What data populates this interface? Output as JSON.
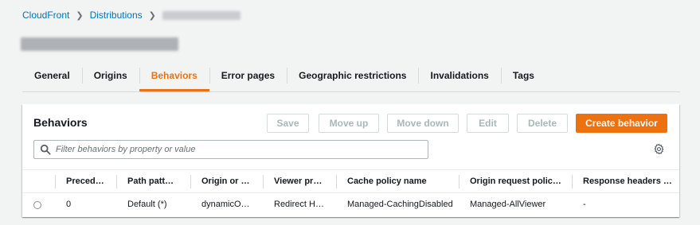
{
  "breadcrumb": {
    "root": "CloudFront",
    "section": "Distributions"
  },
  "tabs": [
    "General",
    "Origins",
    "Behaviors",
    "Error pages",
    "Geographic restrictions",
    "Invalidations",
    "Tags"
  ],
  "active_tab": "Behaviors",
  "panel": {
    "title": "Behaviors",
    "buttons": {
      "save": "Save",
      "move_up": "Move up",
      "move_down": "Move down",
      "edit": "Edit",
      "delete": "Delete",
      "create": "Create behavior"
    },
    "search_placeholder": "Filter behaviors by property or value"
  },
  "table": {
    "columns": [
      "Preced…",
      "Path patt…",
      "Origin or …",
      "Viewer pr…",
      "Cache policy name",
      "Origin request polic…",
      "Response headers …"
    ],
    "rows": [
      {
        "precedence": "0",
        "path": "Default (*)",
        "origin": "dynamicO…",
        "viewer": "Redirect H…",
        "cache": "Managed-CachingDisabled",
        "origin_request": "Managed-AllViewer",
        "response_headers": "-"
      }
    ]
  },
  "colors": {
    "accent": "#ec7211",
    "link": "#0073bb"
  },
  "icons": {
    "search": "search-icon",
    "settings": "gear-icon",
    "separator": "chevron-right-icon"
  }
}
